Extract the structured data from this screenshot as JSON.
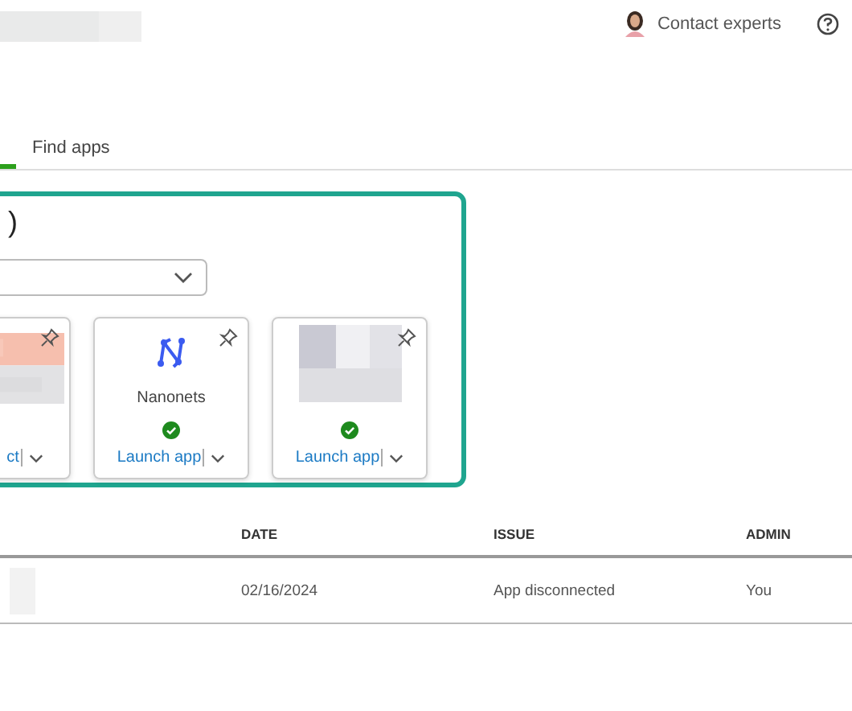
{
  "header": {
    "contact_label": "Contact experts"
  },
  "tabs": [
    {
      "selected": true
    },
    {
      "label": "Find apps",
      "selected": false
    }
  ],
  "apps_panel": {
    "heading": ")",
    "cards": [
      {
        "kind": "picture",
        "link": "ct"
      },
      {
        "kind": "logo",
        "name": "Nanonets",
        "connected": true,
        "link": "Launch app"
      },
      {
        "kind": "picture",
        "connected": true,
        "link": "Launch app"
      }
    ]
  },
  "table": {
    "columns": [
      "DATE",
      "ISSUE",
      "ADMIN"
    ],
    "rows": [
      {
        "cells": [
          "02/16/2024",
          "App disconnected",
          "You"
        ]
      }
    ]
  }
}
